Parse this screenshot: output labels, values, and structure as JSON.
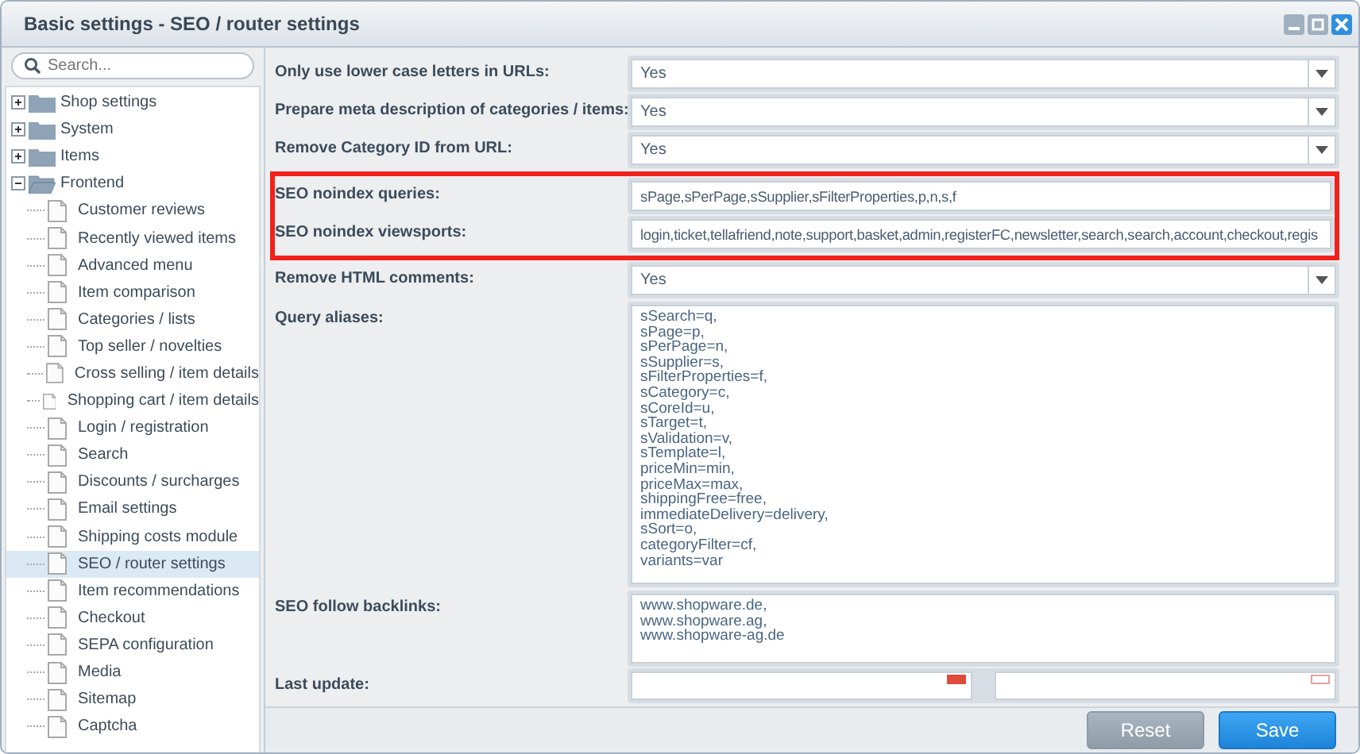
{
  "window": {
    "title": "Basic settings - SEO / router settings"
  },
  "sidebar": {
    "search": {
      "placeholder": "Search..."
    },
    "tree": [
      {
        "label": "Shop settings",
        "expanded": false,
        "selected": false
      },
      {
        "label": "System",
        "expanded": false,
        "selected": false
      },
      {
        "label": "Items",
        "expanded": false,
        "selected": false
      },
      {
        "label": "Frontend",
        "expanded": true,
        "selected": false,
        "children": [
          {
            "label": "Customer reviews",
            "selected": false
          },
          {
            "label": "Recently viewed items",
            "selected": false
          },
          {
            "label": "Advanced menu",
            "selected": false
          },
          {
            "label": "Item comparison",
            "selected": false
          },
          {
            "label": "Categories / lists",
            "selected": false
          },
          {
            "label": "Top seller / novelties",
            "selected": false
          },
          {
            "label": "Cross selling / item details",
            "selected": false
          },
          {
            "label": "Shopping cart / item details",
            "selected": false
          },
          {
            "label": "Login / registration",
            "selected": false
          },
          {
            "label": "Search",
            "selected": false
          },
          {
            "label": "Discounts / surcharges",
            "selected": false
          },
          {
            "label": "Email settings",
            "selected": false
          },
          {
            "label": "Shipping costs module",
            "selected": false
          },
          {
            "label": "SEO / router settings",
            "selected": true
          },
          {
            "label": "Item recommendations",
            "selected": false
          },
          {
            "label": "Checkout",
            "selected": false
          },
          {
            "label": "SEPA configuration",
            "selected": false
          },
          {
            "label": "Media",
            "selected": false
          },
          {
            "label": "Sitemap",
            "selected": false
          },
          {
            "label": "Captcha",
            "selected": false
          }
        ]
      }
    ]
  },
  "form": {
    "fields": [
      {
        "kind": "select",
        "label": "Only use lower case letters in URLs:",
        "value": "Yes",
        "highlighted": false
      },
      {
        "kind": "select",
        "label": "Prepare meta description of categories / items:",
        "value": "Yes",
        "highlighted": false
      },
      {
        "kind": "select",
        "label": "Remove Category ID from URL:",
        "value": "Yes",
        "highlighted": false
      },
      {
        "kind": "text",
        "label": "SEO noindex queries:",
        "value": "sPage,sPerPage,sSupplier,sFilterProperties,p,n,s,f",
        "highlighted": true
      },
      {
        "kind": "text",
        "label": "SEO noindex viewsports:",
        "value": "login,ticket,tellafriend,note,support,basket,admin,registerFC,newsletter,search,search,account,checkout,regis",
        "highlighted": true
      },
      {
        "kind": "select",
        "label": "Remove HTML comments:",
        "value": "Yes",
        "highlighted": false
      },
      {
        "kind": "textarea",
        "label": "Query aliases:",
        "lines": [
          "sSearch=q,",
          "sPage=p,",
          "sPerPage=n,",
          "sSupplier=s,",
          "sFilterProperties=f,",
          "sCategory=c,",
          "sCoreId=u,",
          "sTarget=t,",
          "sValidation=v,",
          "sTemplate=l,",
          "priceMin=min,",
          "priceMax=max,",
          "shippingFree=free,",
          "immediateDelivery=delivery,",
          "sSort=o,",
          "categoryFilter=cf,",
          "variants=var"
        ],
        "highlighted": false
      },
      {
        "kind": "textarea",
        "label": "SEO follow backlinks:",
        "lines": [
          "www.shopware.de,",
          "www.shopware.ag,",
          "www.shopware-ag.de"
        ],
        "highlighted": false
      },
      {
        "kind": "datetime",
        "label": "Last update:",
        "highlighted": false
      }
    ]
  },
  "buttons": [
    {
      "kind": "reset",
      "label": "Reset"
    },
    {
      "kind": "save",
      "label": "Save"
    }
  ]
}
